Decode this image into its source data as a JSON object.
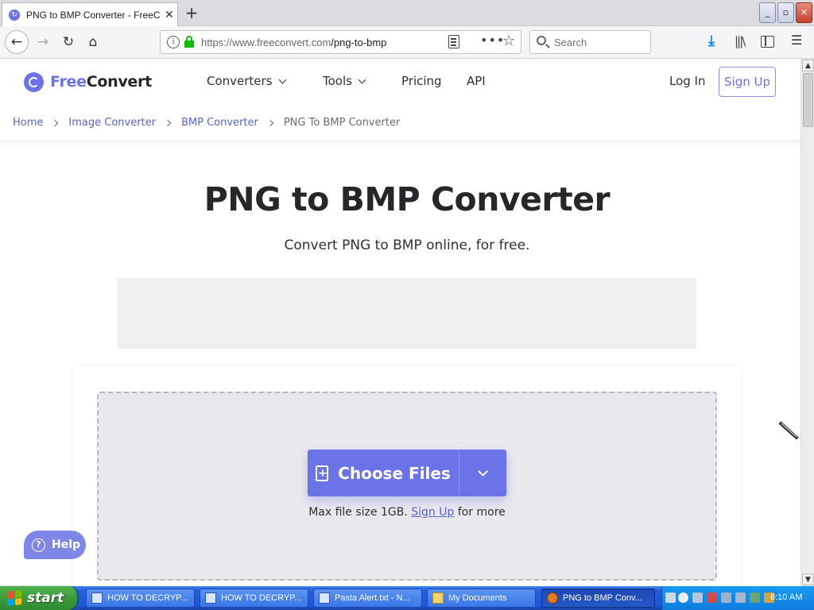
{
  "browser": {
    "tab_title": "PNG to BMP Converter - FreeConvert",
    "new_tab": "+",
    "window_buttons": {
      "minimize": "_",
      "maximize": "▫",
      "close": "✕"
    },
    "url_host": "https://www.freeconvert.com",
    "url_path": "/png-to-bmp",
    "search_placeholder": "Search",
    "icons": [
      "back-icon",
      "forward-icon",
      "reload-icon",
      "home-icon",
      "info-icon",
      "lock-icon",
      "reader-view-icon",
      "page-actions-icon",
      "bookmark-star-icon",
      "search-icon",
      "download-icon",
      "library-icon",
      "sidebar-icon",
      "menu-icon"
    ]
  },
  "site": {
    "logo_free": "Free",
    "logo_convert": "Convert",
    "nav": {
      "converters": "Converters",
      "tools": "Tools",
      "pricing": "Pricing",
      "api": "API"
    },
    "login": "Log In",
    "signup": "Sign Up",
    "accent_color": "#6a74e8"
  },
  "breadcrumb": {
    "home": "Home",
    "image_converter": "Image Converter",
    "bmp_converter": "BMP Converter",
    "current": "PNG To BMP Converter"
  },
  "hero": {
    "title": "PNG to BMP Converter",
    "subtitle": "Convert PNG to BMP online, for free."
  },
  "upload": {
    "choose_files": "Choose Files",
    "max_size_prefix": "Max file size 1GB.",
    "signup_link": "Sign Up",
    "max_size_suffix": "for more"
  },
  "help": {
    "label": "Help"
  },
  "taskbar": {
    "start": "start",
    "tasks": [
      {
        "label": "HOW TO DECRYP..."
      },
      {
        "label": "HOW TO DECRYP..."
      },
      {
        "label": "Pasta Alert.txt - N..."
      },
      {
        "label": "My Documents"
      },
      {
        "label": "PNG to BMP Conv..."
      }
    ],
    "clock": "6:10 AM"
  }
}
